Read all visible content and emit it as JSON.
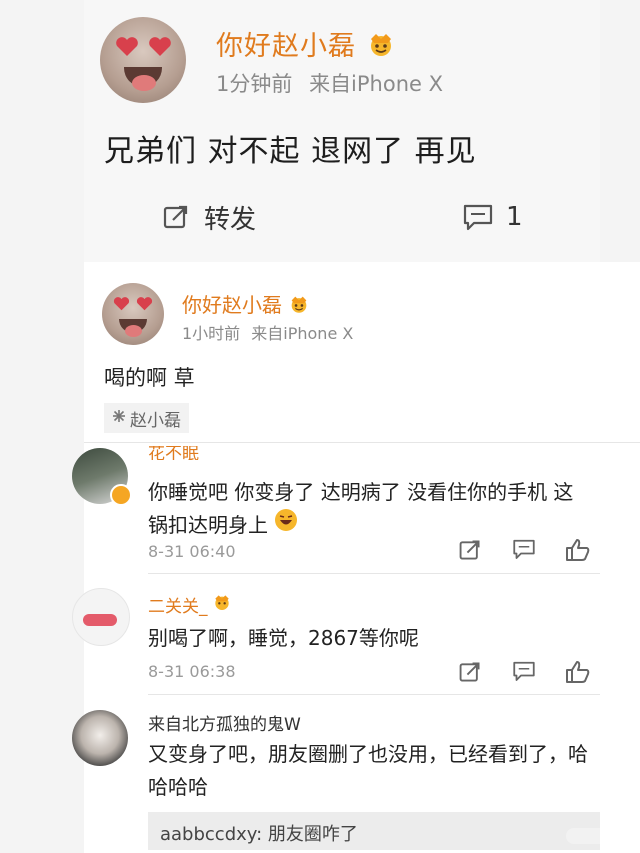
{
  "post": {
    "author": "你好赵小磊",
    "time": "1分钟前",
    "source": "来自iPhone X",
    "content": "兄弟们 对不起 退网了 再见",
    "repost_label": "转发",
    "comment_count": "1"
  },
  "comment": {
    "author": "你好赵小磊",
    "time": "1小时前",
    "source": "来自iPhone X",
    "content": "喝的啊 草",
    "tag": "赵小磊"
  },
  "replies": [
    {
      "author": "花不眠",
      "text_line1": "你睡觉吧 你变身了 达明病了 没看住你的手机 这",
      "text_line2": "锅扣达明身上",
      "time": "8-31 06:40"
    },
    {
      "author": "二关关_",
      "text_line1": "别喝了啊，睡觉，2867等你呢",
      "time": "8-31 06:38"
    },
    {
      "author": "来自北方孤独的鬼W",
      "text_line1": "又变身了吧，朋友圈删了也没用，已经看到了，哈",
      "text_line2": "哈哈哈",
      "subreply": "aabbccdxy: 朋友圈咋了"
    }
  ],
  "colors": {
    "username": "#e07b1e",
    "meta": "#8a8a8a",
    "text": "#222222"
  },
  "icons": [
    "crown-icon",
    "repost-icon",
    "comment-icon",
    "like-icon",
    "tag-icon"
  ]
}
